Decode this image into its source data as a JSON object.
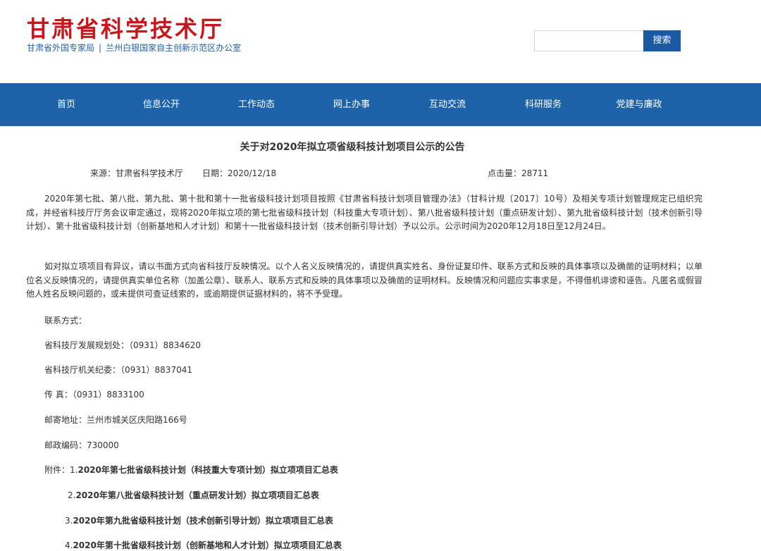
{
  "header": {
    "site_title": "甘肃省科学技术厅",
    "subtitle_left": "甘肃省外国专家局",
    "subtitle_sep": "|",
    "subtitle_right": "兰州白银国家自主创新示范区办公室",
    "search_placeholder": "",
    "search_button": "搜索"
  },
  "colors": {
    "brand_red": "#c8161d",
    "brand_blue": "#1e62aa",
    "search_button_blue": "#1a5aa3"
  },
  "nav": {
    "items": [
      "首页",
      "信息公开",
      "工作动态",
      "网上办事",
      "互动交流",
      "科研服务",
      "党建与廉政"
    ]
  },
  "article": {
    "title": "关于对2020年拟立项省级科技计划项目公示的公告",
    "source": "来源：甘肃省科学技术厅",
    "date": "日期：2020/12/18",
    "hits": "点击量：28711",
    "paragraph1": "2020年第七批、第八批、第九批、第十批和第十一批省级科技计划项目按照《甘肃省科技计划项目管理办法》（甘科计规〔2017〕10号）及相关专项计划管理规定已组织完成，并经省科技厅厅务会议审定通过，现将2020年拟立项的第七批省级科技计划（科技重大专项计划）、第八批省级科技计划（重点研发计划）、第九批省级科技计划（技术创新引导计划）、第十批省级科技计划（创新基地和人才计划）和第十一批省级科技计划（技术创新引导计划）予以公示。公示时间为2020年12月18日至12月24日。",
    "paragraph2": "如对拟立项项目有异议，请以书面方式向省科技厅反映情况。以个人名义反映情况的，请提供真实姓名、身份证复印件、联系方式和反映的具体事项以及确凿的证明材料；以单位名义反映情况的，请提供真实单位名称（加盖公章）、联系人、联系方式和反映的具体事项以及确凿的证明材料。反映情况和问题应实事求是，不得借机诽谤和诬告。凡匿名或假冒他人姓名反映问题的，或未提供可查证线索的，或逾期提供证据材料的，将不予受理。",
    "contact_label": "联系方式：",
    "contacts": [
      "省科技厅发展规划处：（0931）8834620",
      "省科技厅机关纪委：（0931）8837041",
      "传 真：（0931）8833100",
      "邮寄地址：兰州市城关区庆阳路166号",
      "邮政编码：730000"
    ],
    "attachments_label": "附件：",
    "attachments": [
      {
        "num": "1.",
        "title": "2020年第七批省级科技计划（科技重大专项计划）拟立项项目汇总表"
      },
      {
        "num": "2.",
        "title": "2020年第八批省级科技计划（重点研发计划）拟立项项目汇总表"
      },
      {
        "num": "3.",
        "title": "2020年第九批省级科技计划（技术创新引导计划）拟立项项目汇总表"
      },
      {
        "num": "4.",
        "title": "2020年第十批省级科技计划（创新基地和人才计划）拟立项项目汇总表"
      }
    ]
  }
}
